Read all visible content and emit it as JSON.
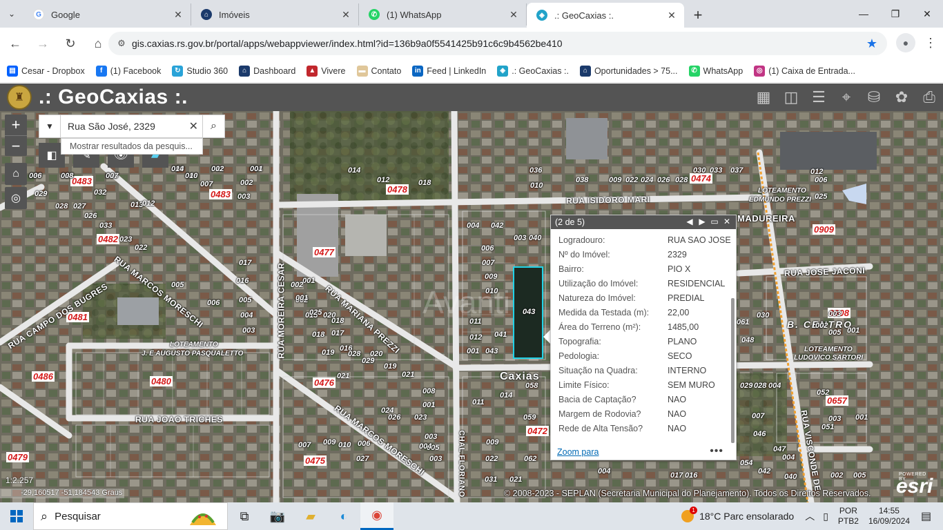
{
  "browser": {
    "tabs": [
      {
        "title": "Google",
        "icon": "google-icon",
        "color": "#4285f4",
        "glyph": "G"
      },
      {
        "title": "Imóveis",
        "icon": "house-icon",
        "color": "#1b3a6b",
        "glyph": "⌂"
      },
      {
        "title": "(1) WhatsApp",
        "icon": "whatsapp-icon",
        "color": "#25d366",
        "glyph": "✆"
      },
      {
        "title": ".: GeoCaxias :.",
        "icon": "geocaxias-icon",
        "color": "#22a3c9",
        "glyph": "◈"
      }
    ],
    "url": "gis.caxias.rs.gov.br/portal/apps/webappviewer/index.html?id=136b9a0f5541425b91c6c9b4562be410",
    "bookmarks": [
      {
        "label": "Cesar - Dropbox",
        "color": "#0061fe",
        "glyph": "▤"
      },
      {
        "label": "(1) Facebook",
        "color": "#1877f2",
        "glyph": "f"
      },
      {
        "label": "Studio 360",
        "color": "#29a3d8",
        "glyph": "↻"
      },
      {
        "label": "Dashboard",
        "color": "#1b3a6b",
        "glyph": "⌂"
      },
      {
        "label": "Vivere",
        "color": "#c1272d",
        "glyph": "▲"
      },
      {
        "label": "Contato",
        "color": "#e0c79a",
        "glyph": "▬"
      },
      {
        "label": "Feed | LinkedIn",
        "color": "#0a66c2",
        "glyph": "in"
      },
      {
        "label": ".: GeoCaxias :.",
        "color": "#22a3c9",
        "glyph": "◈"
      },
      {
        "label": "Oportunidades > 75...",
        "color": "#1b3a6b",
        "glyph": "⌂"
      },
      {
        "label": "WhatsApp",
        "color": "#25d366",
        "glyph": "✆"
      },
      {
        "label": "(1) Caixa de Entrada...",
        "color": "#c13584",
        "glyph": "◎"
      }
    ]
  },
  "app": {
    "title": ".: GeoCaxias :.",
    "search": {
      "value": "Rua São José, 2329",
      "suggestion": "Mostrar resultados da pesquis..."
    }
  },
  "popup": {
    "counter": "(2 de 5)",
    "fields": [
      {
        "label": "Logradouro:",
        "value": "RUA SAO JOSE"
      },
      {
        "label": "Nº do Imóvel:",
        "value": "2329"
      },
      {
        "label": "Bairro:",
        "value": "PIO X"
      },
      {
        "label": "Utilização do Imóvel:",
        "value": "RESIDENCIAL"
      },
      {
        "label": "Natureza do Imóvel:",
        "value": "PREDIAL"
      },
      {
        "label": "Medida da Testada (m):",
        "value": "22,00"
      },
      {
        "label": "Área do Terreno (m²):",
        "value": "1485,00"
      },
      {
        "label": "Topografia:",
        "value": "PLANO"
      },
      {
        "label": "Pedologia:",
        "value": "SECO"
      },
      {
        "label": "Situação na Quadra:",
        "value": "INTERNO"
      },
      {
        "label": "Limite Físico:",
        "value": "SEM MURO"
      },
      {
        "label": "Bacia de Captação?",
        "value": "NAO"
      },
      {
        "label": "Margem de Rodovia?",
        "value": "NAO"
      },
      {
        "label": "Rede de Alta Tensão?",
        "value": "NAO"
      }
    ],
    "zoom_label": "Zoom para"
  },
  "map": {
    "scale": "1:2.257",
    "coordinates": "-29,160517 -51,184543 Graus",
    "copyright": "© 2008-2023 - SEPLAN (Secretaria Municipal do Planejamento). Todos os Direitos Reservados.",
    "esri": "esri",
    "esri_powered": "POWERED BY",
    "city_label": "Caxias",
    "watermark": "Avanti",
    "streets": [
      "RUA ISIDORO MARI",
      "MADUREIRA",
      "RUA JOSE JACONI",
      "RUA MARIANA PREZZI",
      "RUA MOREIRA CESAR",
      "RUA MARCOS MORESCHI",
      "RUA MARCOS MORESCHI",
      "RUA CAMPO DOS BUGRES",
      "RUA JOAO TRICHES",
      "CHAL FLORIANO",
      "RUA VISCONDE DE",
      "B. CENTRO"
    ],
    "subdivisions": [
      "LOTEAMENTO",
      "EDMUNDO PREZZI",
      "LOTEAMENTO",
      "J. E AUGUSTO PASQUALETTO",
      "LOTEAMENTO",
      "LUDOVICO SARTORI"
    ],
    "blocks": [
      "0483",
      "0483",
      "0478",
      "0474",
      "0909",
      "0482",
      "0477",
      "0481",
      "0908",
      "0486",
      "0480",
      "0476",
      "0472",
      "0657",
      "0475",
      "0479"
    ],
    "lots": [
      "009",
      "011",
      "004",
      "030",
      "024",
      "015",
      "008",
      "007",
      "003",
      "002",
      "014",
      "012",
      "018",
      "036",
      "010",
      "038",
      "009",
      "022",
      "024",
      "026",
      "028",
      "030",
      "033",
      "037",
      "012",
      "006",
      "025",
      "029",
      "028",
      "027",
      "026",
      "032",
      "013",
      "012",
      "033",
      "022",
      "023",
      "004",
      "042",
      "003",
      "040",
      "006",
      "007",
      "009",
      "010",
      "011",
      "012",
      "041",
      "001",
      "020",
      "043",
      "001",
      "002",
      "015",
      "018",
      "019",
      "020",
      "021",
      "005",
      "006",
      "017",
      "016",
      "005",
      "004",
      "003",
      "002",
      "001",
      "025",
      "018",
      "017",
      "016",
      "028",
      "029",
      "019",
      "021",
      "023",
      "024",
      "026",
      "027",
      "006",
      "010",
      "003",
      "005",
      "004",
      "003",
      "008",
      "009",
      "007",
      "001",
      "014",
      "011",
      "009",
      "058",
      "059",
      "062",
      "021",
      "022",
      "031",
      "030",
      "029",
      "028",
      "004",
      "052",
      "051",
      "007",
      "001",
      "002",
      "005",
      "004",
      "016",
      "017",
      "054",
      "042",
      "040",
      "046",
      "047",
      "048",
      "001",
      "005",
      "003",
      "002",
      "061",
      "003",
      "004",
      "014",
      "002",
      "001",
      "006",
      "008",
      "007",
      "010"
    ],
    "selected_lot": "043"
  },
  "taskbar": {
    "search_placeholder": "Pesquisar",
    "weather": "18°C  Parc ensolarado",
    "lang_1": "POR",
    "lang_2": "PTB2",
    "time": "14:55",
    "date": "16/09/2024"
  }
}
